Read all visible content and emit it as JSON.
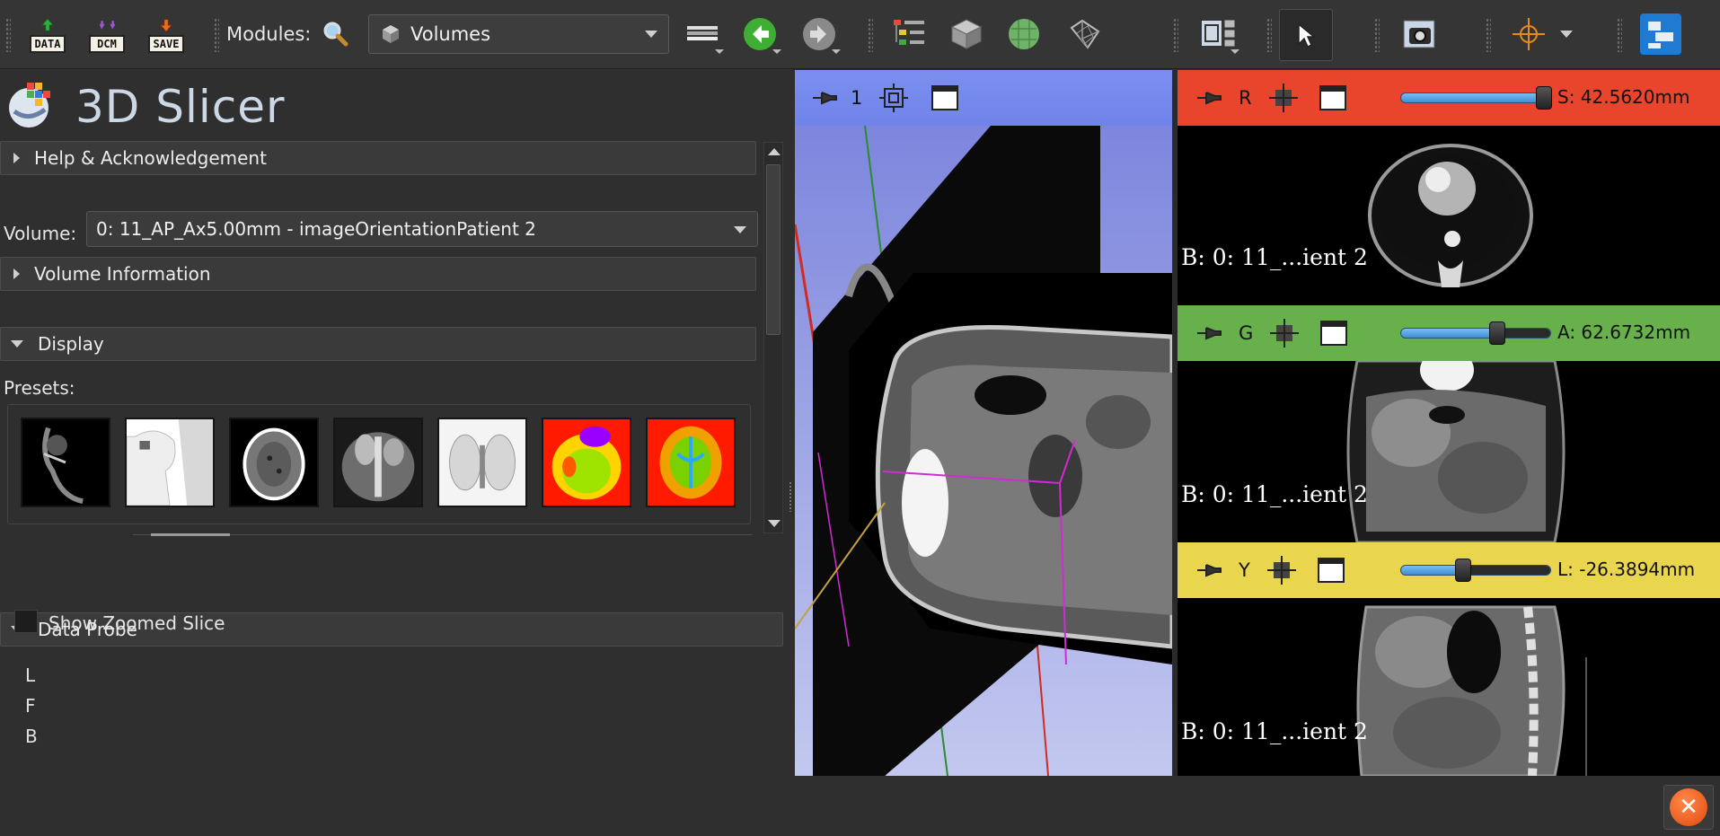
{
  "app": {
    "title": "3D Slicer"
  },
  "toolbar": {
    "data_label": "DATA",
    "dcm_label": "DCM",
    "save_label": "SAVE",
    "modules_label": "Modules:",
    "module_selected": "Volumes"
  },
  "panel": {
    "sections": {
      "help": "Help & Acknowledgement",
      "volume_info": "Volume Information",
      "display": "Display",
      "data_probe": "Data Probe"
    },
    "volume_label": "Volume:",
    "volume_value": "0: 11_AP_Ax5.00mm - imageOrientationPatient 2",
    "presets_label": "Presets:",
    "presets": [
      "ct-bone",
      "ct-air",
      "ct-brain",
      "ct-abdomen",
      "ct-lung",
      "pet",
      "dti"
    ],
    "show_zoomed_slice": "Show Zoomed Slice",
    "probe_lines": [
      "L",
      "F",
      "B"
    ]
  },
  "view3d": {
    "label": "1",
    "background": "#8c95e6"
  },
  "slices": {
    "red": {
      "letter": "R",
      "offset": "S: 42.5620mm",
      "background_text": "B: 0: 11_...ient 2",
      "color": "#e8452c",
      "slider_pos": 0.95
    },
    "green": {
      "letter": "G",
      "offset": "A: 62.6732mm",
      "background_text": "B: 0: 11_...ient 2",
      "color": "#68b04b",
      "slider_pos": 0.64
    },
    "yellow": {
      "letter": "Y",
      "offset": "L: -26.3894mm",
      "background_text": "B: 0: 11_...ient 2",
      "color": "#e9d64e",
      "slider_pos": 0.42
    }
  },
  "colors": {
    "toolbar": "#353535",
    "panel": "#2f2f2f",
    "accent_close": "#e14a0d"
  },
  "icons": {
    "toolbar": [
      "data-load-icon",
      "dicom-icon",
      "save-icon",
      "module-search-icon",
      "volumes-cube-icon",
      "layout-icon",
      "back-arrow-icon",
      "forward-arrow-icon",
      "extension-tree-icon",
      "cube-grid-icon",
      "sphere-icon",
      "cube-wire-icon",
      "layout-grid-icon",
      "mouse-pointer-icon",
      "screenshot-camera-icon",
      "crosshair-icon",
      "extension-manager-icon"
    ]
  }
}
